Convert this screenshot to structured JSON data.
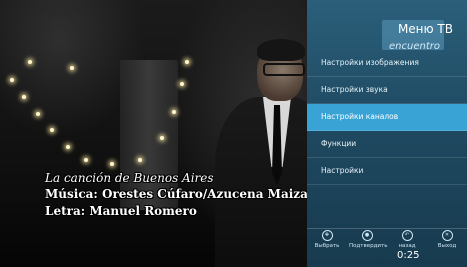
{
  "video": {
    "captions": {
      "title": "La canción de Buenos Aires",
      "music": "Música: Orestes Cúfaro/Azucena Maizani",
      "lyrics": "Letra: Manuel Romero"
    }
  },
  "menu": {
    "title": "Меню ТВ",
    "channel_name": "encuentro",
    "items": [
      {
        "label": "Настройки изображения",
        "selected": false
      },
      {
        "label": "Настройки звука",
        "selected": false
      },
      {
        "label": "Настройки каналов",
        "selected": true
      },
      {
        "label": "Функции",
        "selected": false
      },
      {
        "label": "Настройки",
        "selected": false
      }
    ],
    "buttons": [
      {
        "label": "Выбрать",
        "icon": "select-icon"
      },
      {
        "label": "Подтвердить",
        "icon": "ok-icon"
      },
      {
        "label": "назад",
        "icon": "back-icon"
      },
      {
        "label": "Выход",
        "icon": "exit-icon"
      }
    ],
    "timer": "0:25"
  }
}
